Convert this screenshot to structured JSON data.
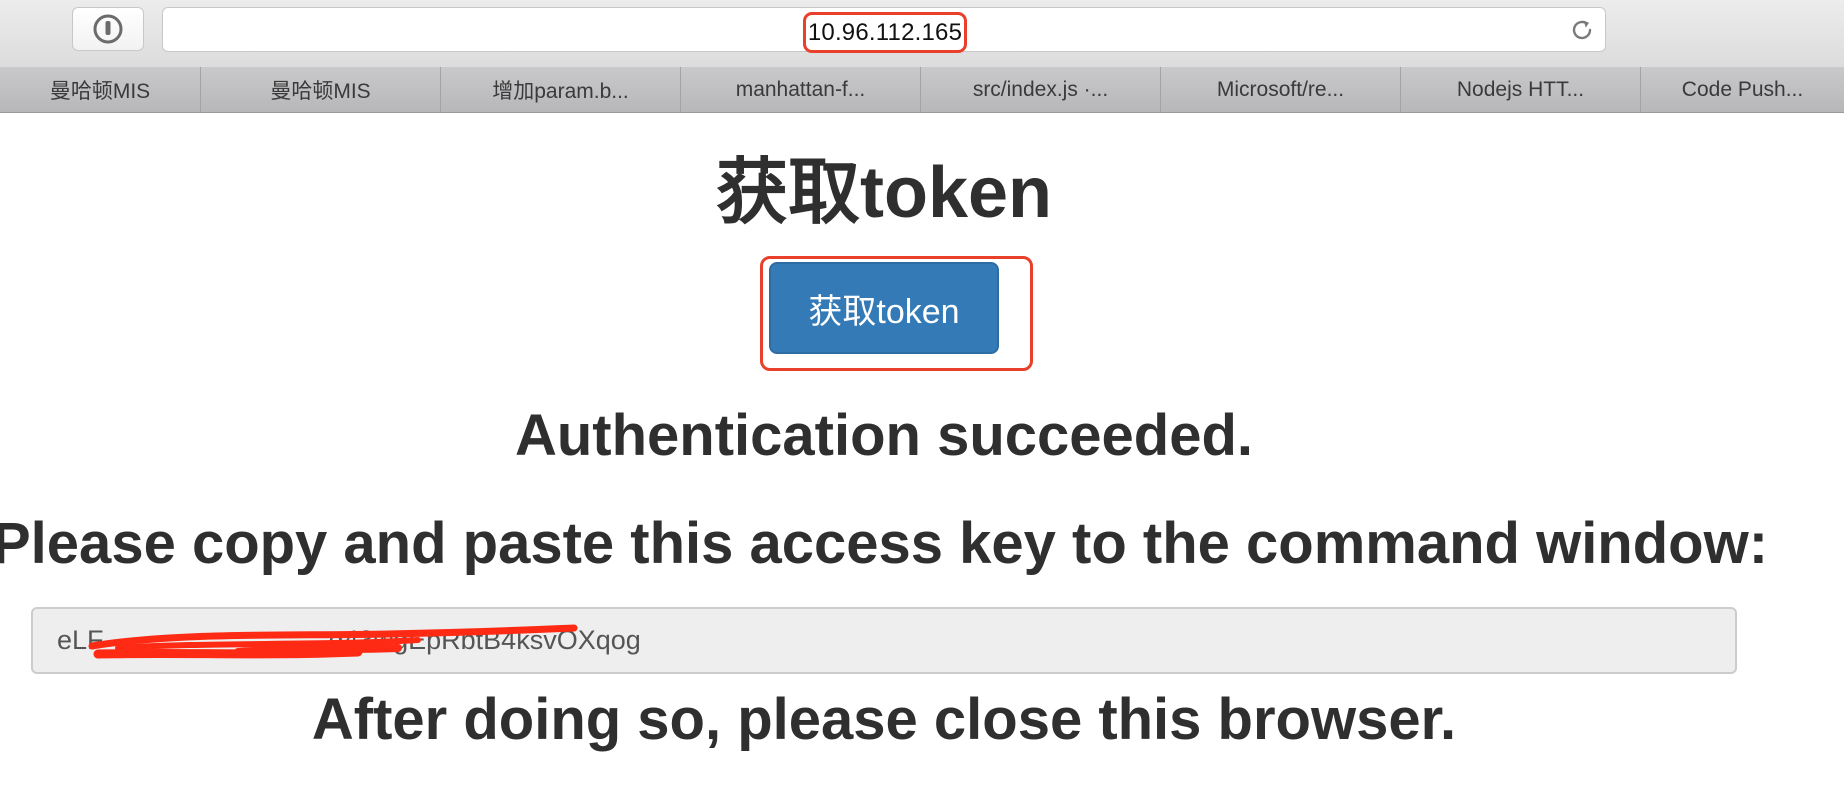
{
  "browser": {
    "url": "10.96.112.165",
    "icons": {
      "extension": "password-manager-keyhole-icon",
      "reload": "reload-icon"
    },
    "colors": {
      "highlight": "#e8402a"
    }
  },
  "bookmarks": [
    {
      "label": "曼哈顿MIS"
    },
    {
      "label": "曼哈顿MIS"
    },
    {
      "label": "增加param.b..."
    },
    {
      "label": "manhattan-f..."
    },
    {
      "label": "src/index.js ·..."
    },
    {
      "label": "Microsoft/re..."
    },
    {
      "label": "Nodejs HTT..."
    },
    {
      "label": "Code Push..."
    }
  ],
  "page": {
    "title": "获取token",
    "button_label": "获取token",
    "auth_message": "Authentication succeeded.",
    "copy_instruction": "Please copy and paste this access key to the command window:",
    "access_key_visible": "eLF                              g43wgEpRbtB4ksvOXqog",
    "after_message": "After doing so, please close this browser.",
    "colors": {
      "button": "#337ab7",
      "text": "#2f2f2f"
    }
  }
}
